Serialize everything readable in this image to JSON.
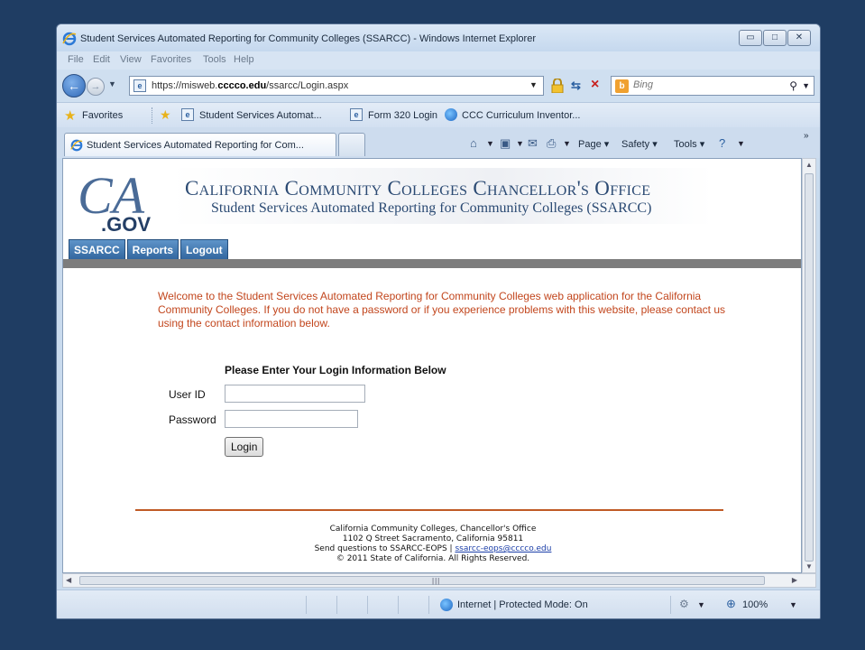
{
  "window": {
    "title": "Student Services Automated Reporting for Community Colleges (SSARCC) - Windows Internet Explorer"
  },
  "menu": [
    "File",
    "Edit",
    "View",
    "Favorites",
    "Tools",
    "Help"
  ],
  "address": {
    "prefix": "https://misweb.",
    "host": "cccco.edu",
    "path": "/ssarcc/Login.aspx"
  },
  "search": {
    "placeholder": "Bing"
  },
  "favorites": {
    "label": "Favorites",
    "links": [
      "Student Services Automat...",
      "Form 320 Login",
      "CCC Curriculum Inventor..."
    ]
  },
  "tab": {
    "label": "Student Services Automated Reporting for Com..."
  },
  "commands": {
    "page": "Page",
    "safety": "Safety",
    "tools": "Tools"
  },
  "page": {
    "logo_text": ".GOV",
    "logo_letters": "CA",
    "header_title": "California Community Colleges Chancellor's Office",
    "header_subtitle": "Student Services Automated Reporting for Community Colleges (SSARCC)",
    "site_tabs": [
      "SSARCC",
      "Reports",
      "Logout"
    ],
    "welcome": "Welcome to the Student Services Automated Reporting for Community Colleges web application for the California Community Colleges. If you do not have a password or if you experience problems with this website, please contact us using the contact information below.",
    "login_heading": "Please Enter Your Login Information Below",
    "userid_label": "User ID",
    "password_label": "Password",
    "login_button": "Login",
    "footer": {
      "line1": "California Community Colleges, Chancellor's Office",
      "line2": "1102 Q Street Sacramento, California 95811",
      "line3_prefix": "Send questions to SSARCC-EOPS | ",
      "email": "ssarcc-eops@cccco.edu",
      "line4": "© 2011 State of California. All Rights Reserved."
    }
  },
  "status": {
    "zone": "Internet | Protected Mode: On",
    "zoom": "100%"
  }
}
